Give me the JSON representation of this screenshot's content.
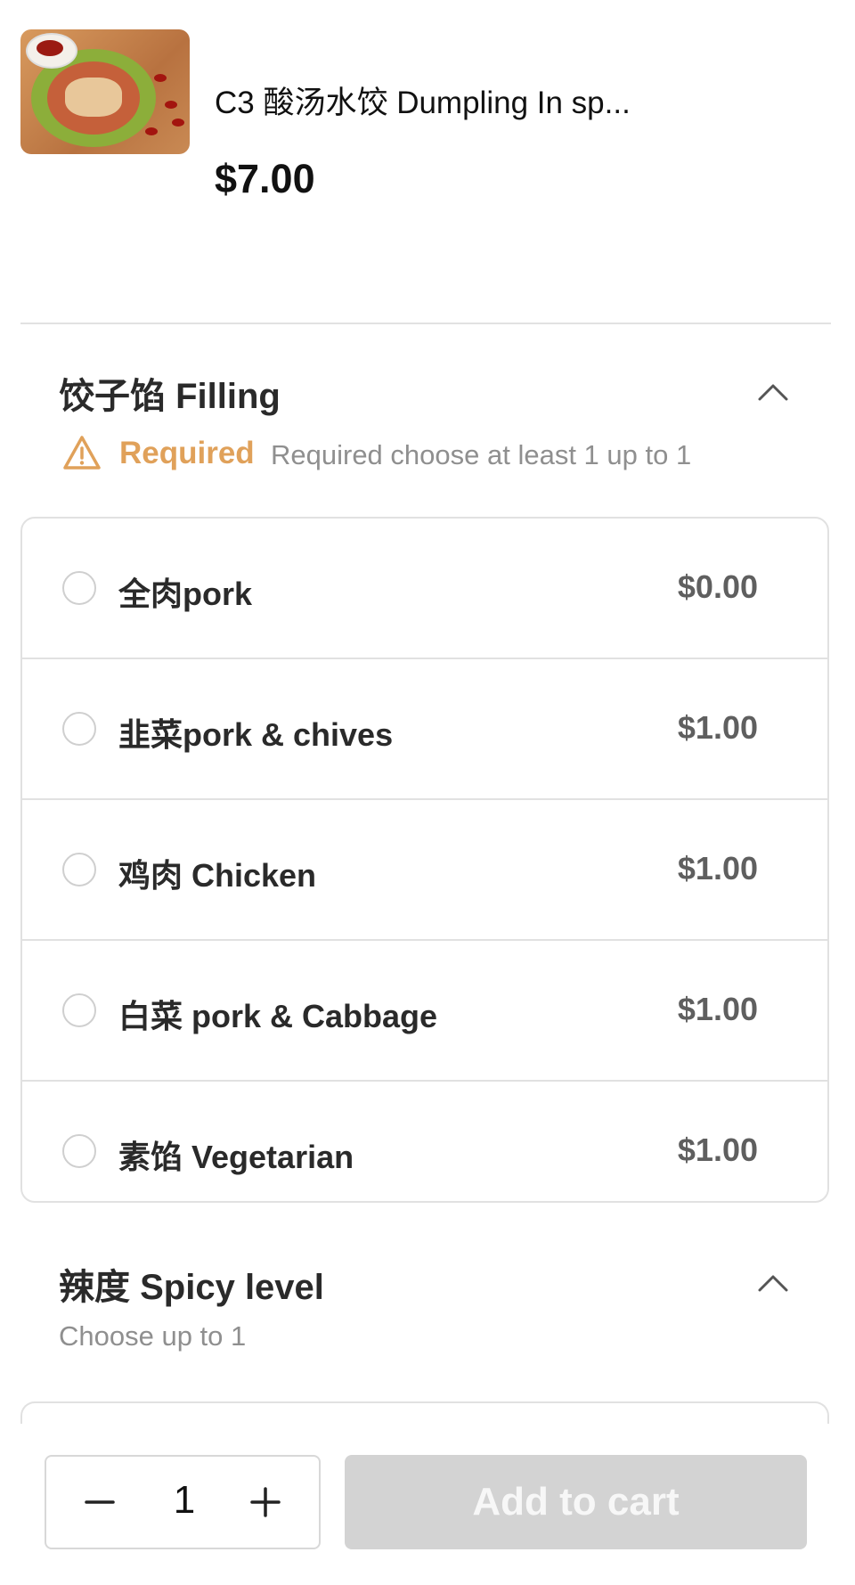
{
  "item": {
    "title": "C3 酸汤水饺 Dumpling In sp...",
    "price": "$7.00"
  },
  "filling": {
    "title": "饺子馅 Filling",
    "required_label": "Required",
    "requirement_text": "Required choose at least 1 up to 1",
    "options": [
      {
        "label": "全肉pork",
        "price": "$0.00"
      },
      {
        "label": "韭菜pork & chives",
        "price": "$1.00"
      },
      {
        "label": "鸡肉 Chicken",
        "price": "$1.00"
      },
      {
        "label": "白菜 pork & Cabbage",
        "price": "$1.00"
      },
      {
        "label": "素馅 Vegetarian",
        "price": "$1.00"
      }
    ]
  },
  "spicy": {
    "title": "辣度 Spicy level",
    "requirement_text": "Choose up to 1"
  },
  "cart": {
    "quantity": "1",
    "add_label": "Add to cart"
  },
  "colors": {
    "required_accent": "#e0a15a",
    "disabled_button": "#d3d3d3"
  },
  "icons": {
    "warning": "warning-triangle-icon",
    "collapse": "chevron-up-icon",
    "minus": "minus-icon",
    "plus": "plus-icon"
  }
}
